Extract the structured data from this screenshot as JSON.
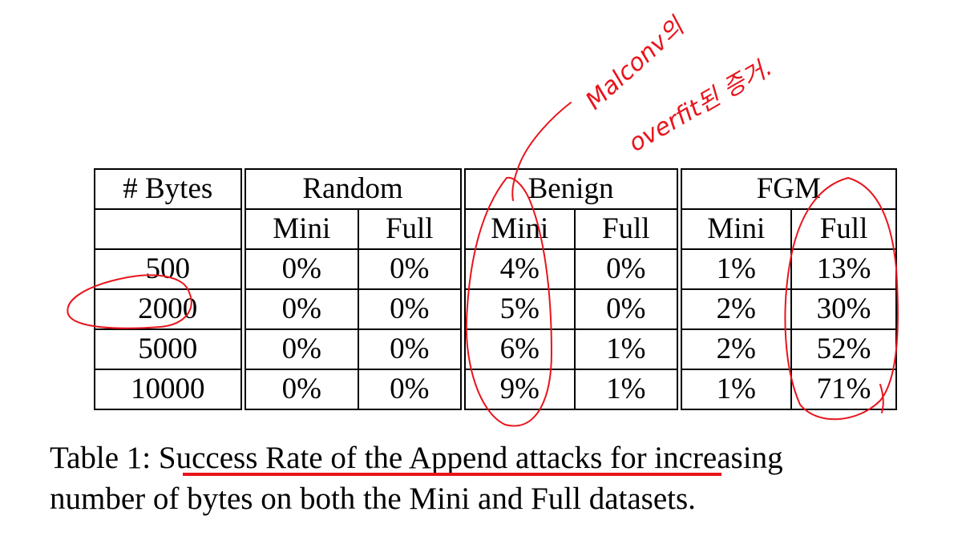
{
  "table": {
    "header_row1": [
      "# Bytes",
      "Random",
      "Benign",
      "FGM"
    ],
    "header_row2": [
      "Mini",
      "Full",
      "Mini",
      "Full",
      "Mini",
      "Full"
    ],
    "rows": [
      [
        "500",
        "0%",
        "0%",
        "4%",
        "0%",
        "1%",
        "13%"
      ],
      [
        "2000",
        "0%",
        "0%",
        "5%",
        "0%",
        "2%",
        "30%"
      ],
      [
        "5000",
        "0%",
        "0%",
        "6%",
        "1%",
        "2%",
        "52%"
      ],
      [
        "10000",
        "0%",
        "0%",
        "9%",
        "1%",
        "1%",
        "71%"
      ]
    ]
  },
  "caption": {
    "label": "Table 1: ",
    "underlined": "Success Rate of the Append attacks",
    "rest_line1": " for increasing",
    "line2": "number of bytes on both the Mini and Full datasets."
  },
  "handwriting": {
    "line1": "Malconv의",
    "line2": "overfit된 증거."
  },
  "colors": {
    "annotation": "#e8141c",
    "text": "#000000"
  }
}
